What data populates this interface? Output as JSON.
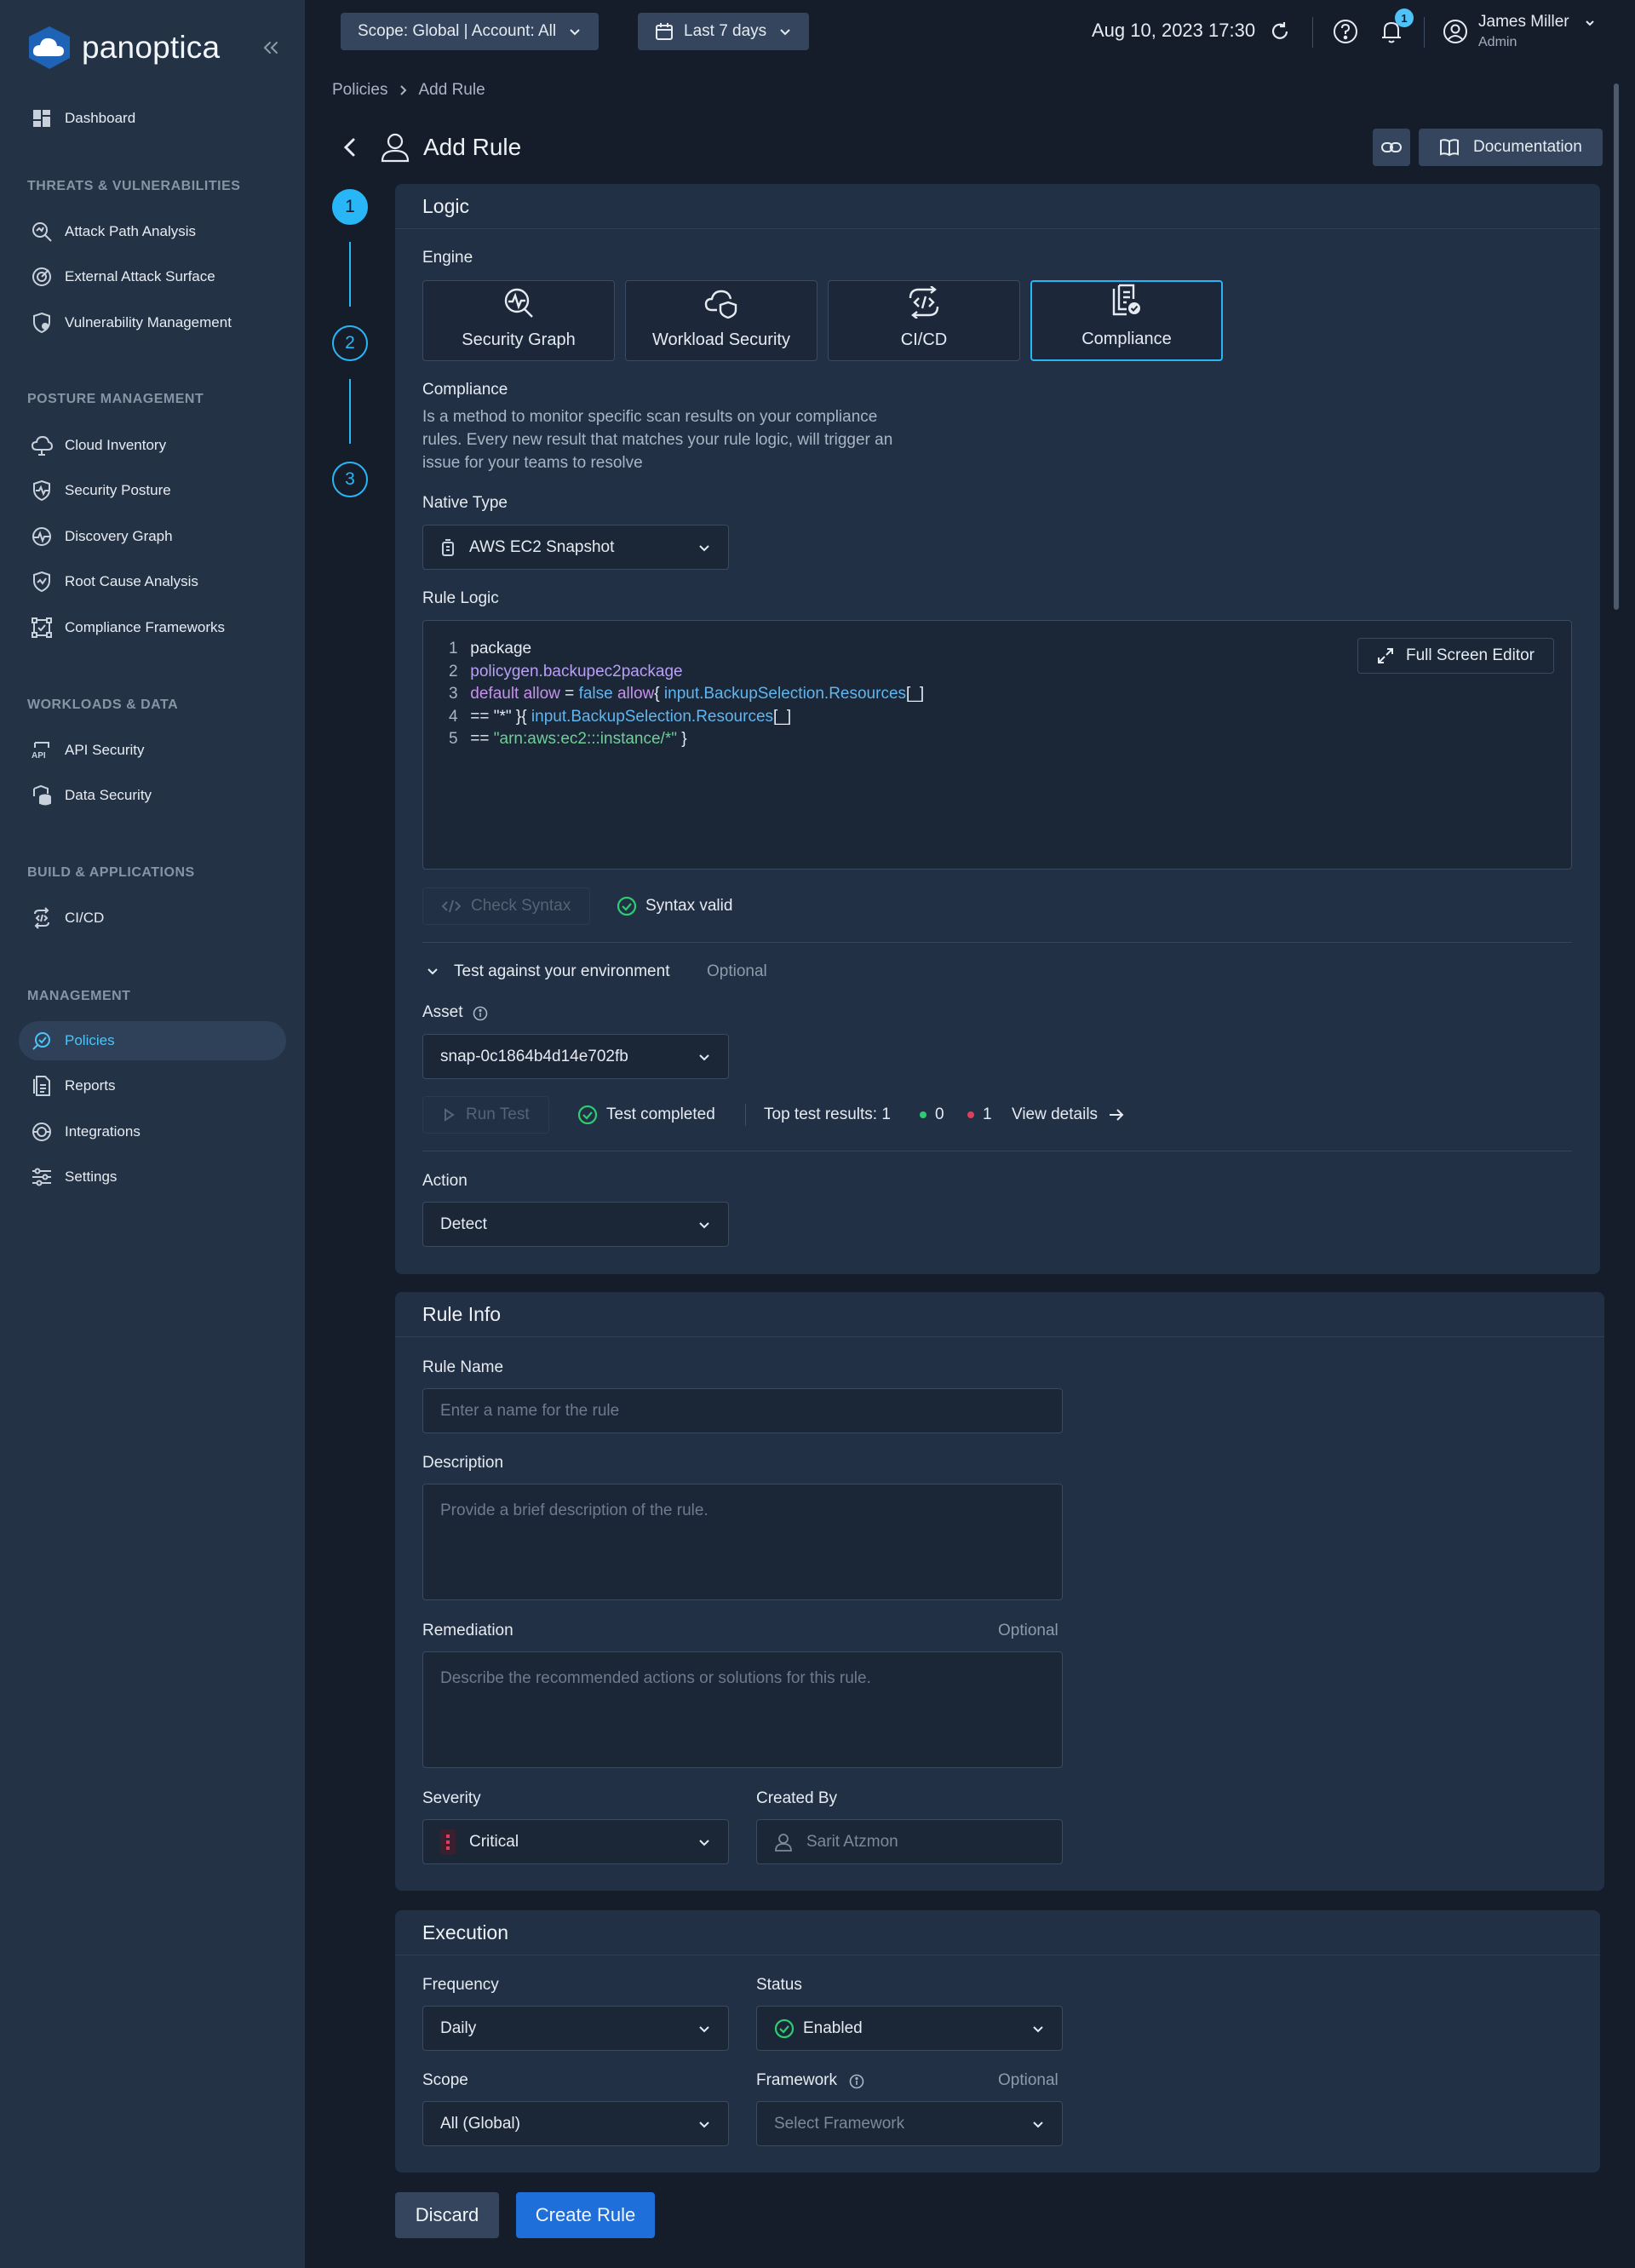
{
  "app": {
    "name": "panoptica"
  },
  "sidebar": {
    "dashboard": "Dashboard",
    "sections": {
      "threats": "THREATS & VULNERABILITIES",
      "posture": "POSTURE MANAGEMENT",
      "workloads": "WORKLOADS & DATA",
      "build": "BUILD & APPLICATIONS",
      "management": "MANAGEMENT"
    },
    "items": {
      "attack_path": "Attack Path Analysis",
      "external_surface": "External Attack Surface",
      "vuln_mgmt": "Vulnerability Management",
      "cloud_inventory": "Cloud Inventory",
      "security_posture": "Security Posture",
      "discovery_graph": "Discovery Graph",
      "root_cause": "Root Cause Analysis",
      "compliance_frameworks": "Compliance Frameworks",
      "api_security": "API Security",
      "data_security": "Data Security",
      "cicd": "CI/CD",
      "policies": "Policies",
      "reports": "Reports",
      "integrations": "Integrations",
      "settings": "Settings"
    },
    "active": "Policies",
    "accent": "#4fc3f7"
  },
  "topbar": {
    "scope": "Scope: Global | Account: All",
    "range": "Last 7 days",
    "datetime": "Aug 10, 2023 17:30",
    "notifications": "1",
    "user_name": "James Miller",
    "user_role": "Admin"
  },
  "breadcrumb": {
    "root": "Policies",
    "current": "Add Rule"
  },
  "page": {
    "title": "Add Rule",
    "documentation": "Documentation"
  },
  "steps": [
    "1",
    "2",
    "3"
  ],
  "logic": {
    "title": "Logic",
    "engine_label": "Engine",
    "engines": [
      "Security Graph",
      "Workload Security",
      "CI/CD",
      "Compliance"
    ],
    "selected_engine": "Compliance",
    "desc_title": "Compliance",
    "desc_lines": [
      "Is a method to monitor specific scan results on your compliance",
      "rules. Every new result that matches your rule logic, will trigger an",
      "issue for your teams to resolve"
    ],
    "native_type_label": "Native Type",
    "native_type": "AWS EC2 Snapshot",
    "rule_logic_label": "Rule Logic",
    "full_screen": "Full Screen Editor",
    "code": {
      "l1": {
        "n": "1",
        "a": "package"
      },
      "l2": {
        "n": "2",
        "a": "policygen.backupec2package"
      },
      "l3": {
        "n": "3",
        "a": "default allow",
        "b": " = ",
        "c": "false",
        "d": " allow",
        "e": "{ ",
        "f": "input.BackupSelection.Resources",
        "g": "[_]"
      },
      "l4": {
        "n": "4",
        "a": "== ",
        "b": "\"*\"",
        "c": " }{ ",
        "d": "input.BackupSelection.Resources",
        "e": "[_]"
      },
      "l5": {
        "n": "5",
        "a": "== ",
        "b": "\"arn:aws:ec2:::instance/*\"",
        "c": " }"
      }
    },
    "check_syntax": "Check Syntax",
    "syntax_status": "Syntax valid",
    "test_title": "Test against your environment",
    "optional": "Optional",
    "asset_label": "Asset",
    "asset": "snap-0c1864b4d14e702fb",
    "run_test": "Run Test",
    "test_status": "Test completed",
    "top_results": "Top test results: 1",
    "pass_count": "0",
    "fail_count": "1",
    "view_details": "View details",
    "action_label": "Action",
    "action": "Detect"
  },
  "rule_info": {
    "title": "Rule Info",
    "name_label": "Rule Name",
    "name_placeholder": "Enter a name for the rule",
    "desc_label": "Description",
    "desc_placeholder": "Provide a brief description of the rule.",
    "remediation_label": "Remediation",
    "optional": "Optional",
    "remediation_placeholder": "Describe the recommended actions or solutions for this rule.",
    "severity_label": "Severity",
    "severity": "Critical",
    "created_by_label": "Created By",
    "created_by": "Sarit Atzmon"
  },
  "execution": {
    "title": "Execution",
    "frequency_label": "Frequency",
    "frequency": "Daily",
    "status_label": "Status",
    "status": "Enabled",
    "scope_label": "Scope",
    "scope": "All (Global)",
    "framework_label": "Framework",
    "optional": "Optional",
    "framework_placeholder": "Select Framework"
  },
  "footer": {
    "discard": "Discard",
    "create": "Create Rule"
  },
  "colors": {
    "accent": "#29b6f6",
    "primary_button": "#1e6fd9",
    "success": "#2ecc71",
    "danger": "#e03e5f"
  }
}
